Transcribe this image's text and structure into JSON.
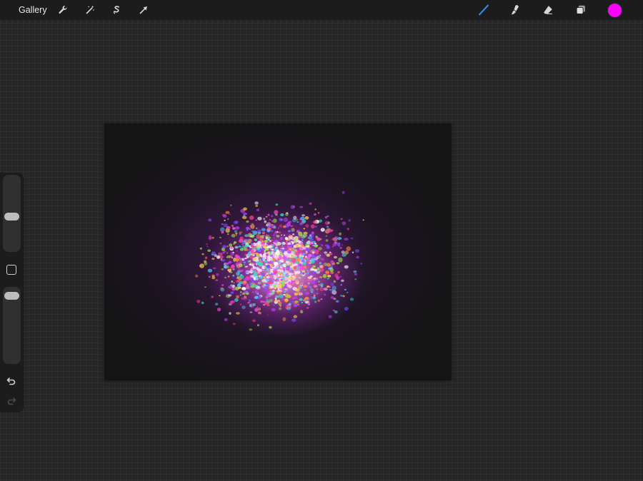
{
  "toolbar": {
    "gallery_label": "Gallery",
    "left_tools": [
      "actions-wrench-icon",
      "adjustments-wand-icon",
      "selection-s-icon",
      "transform-arrow-icon"
    ],
    "right_tools": [
      "brush-icon",
      "smudge-icon",
      "eraser-icon",
      "layers-icon"
    ],
    "active_tool": "brush-icon",
    "color": "#ff00ff"
  },
  "sidebar": {
    "brush_size_level": 0.55,
    "brush_opacity_level": 0.05,
    "controls": [
      "brush-size-slider",
      "modify-button",
      "brush-opacity-slider",
      "undo-icon",
      "redo-icon"
    ]
  },
  "canvas": {
    "background": "#141414",
    "palette": [
      "#ff4fd8",
      "#c040ff",
      "#7a4dff",
      "#ff3f8e",
      "#4fc8ff",
      "#33e0c0",
      "#ffd84a",
      "#ff8a3c",
      "#ffffff",
      "#9fe23f"
    ]
  },
  "colors": {
    "chrome": "#1c1c1c",
    "background": "#262626",
    "accent": "#2f8cff"
  }
}
